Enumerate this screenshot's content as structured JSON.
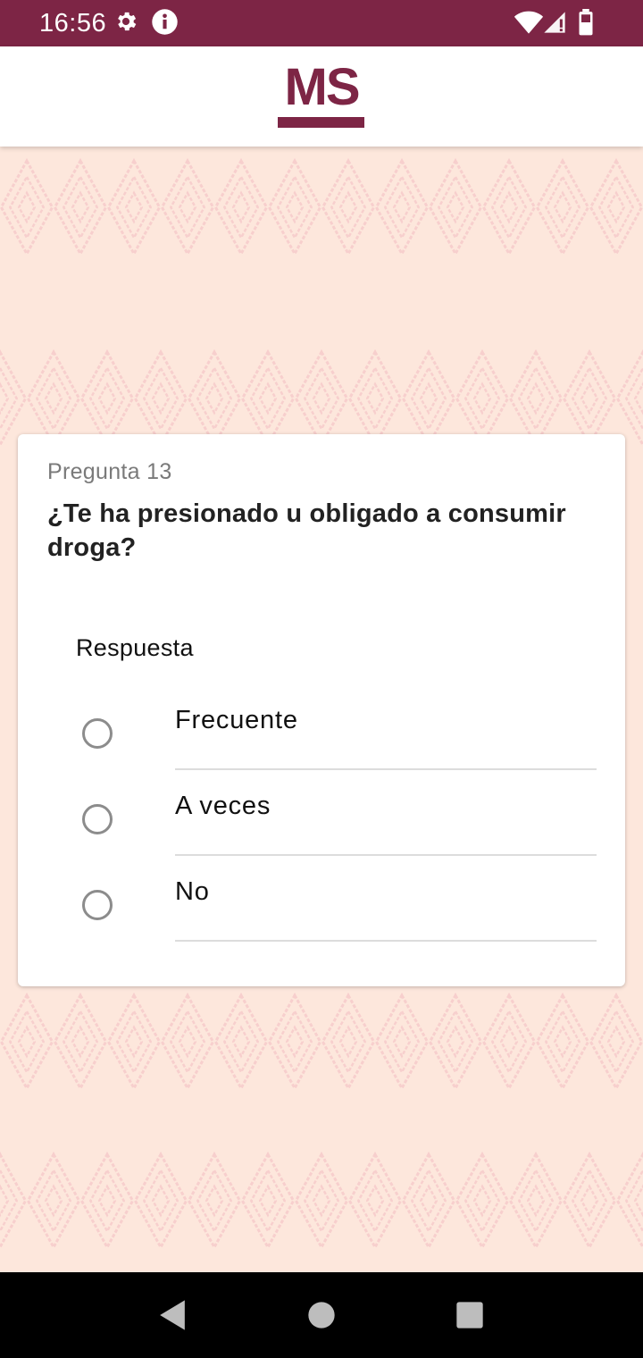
{
  "status_bar": {
    "time": "16:56",
    "background": "#7d2545",
    "icons": [
      "settings-icon",
      "info-icon",
      "wifi-icon",
      "signal-icon",
      "battery-icon"
    ]
  },
  "app_bar": {
    "logo_text": "MS",
    "brand_color": "#7d2545"
  },
  "background": {
    "color": "#fde7dc",
    "pattern_color": "#f3bcc2"
  },
  "question": {
    "number_label": "Pregunta 13",
    "text": "¿Te ha presionado u obligado a consumir droga?",
    "answer_label": "Respuesta",
    "options": [
      {
        "label": "Frecuente",
        "selected": false
      },
      {
        "label": "A veces",
        "selected": false
      },
      {
        "label": "No",
        "selected": false
      }
    ]
  },
  "nav_bar": {
    "buttons": [
      "back-icon",
      "home-icon",
      "recents-icon"
    ]
  }
}
